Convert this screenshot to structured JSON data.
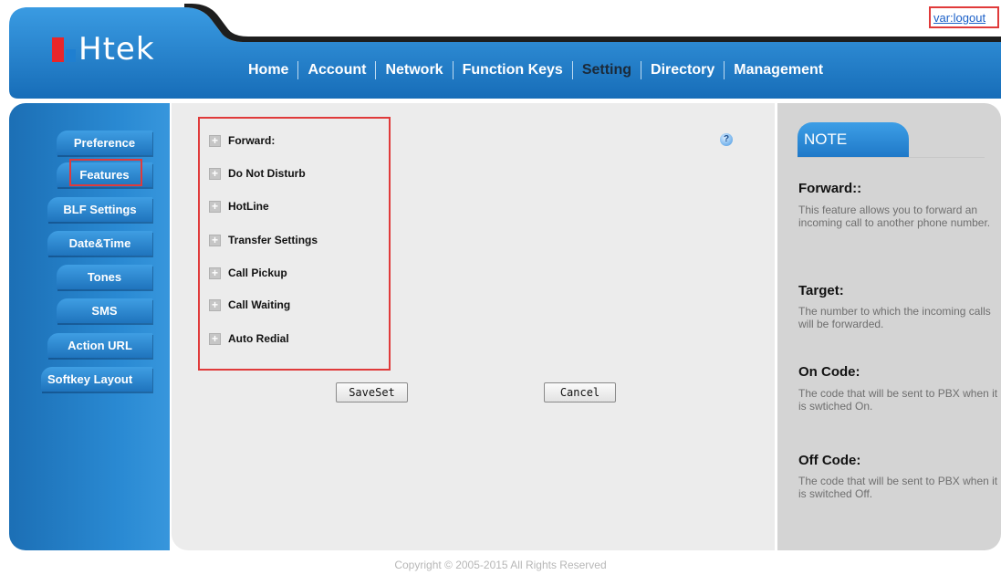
{
  "brand": {
    "logo_text": "Htek",
    "logo_colors": [
      "#e8262a",
      "#1f7fd0"
    ]
  },
  "header": {
    "logout_label": "var:logout"
  },
  "nav": {
    "items": [
      {
        "label": "Home",
        "active": false
      },
      {
        "label": "Account",
        "active": false
      },
      {
        "label": "Network",
        "active": false
      },
      {
        "label": "Function Keys",
        "active": false
      },
      {
        "label": "Setting",
        "active": true
      },
      {
        "label": "Directory",
        "active": false
      },
      {
        "label": "Management",
        "active": false
      }
    ]
  },
  "sidebar": {
    "items": [
      {
        "label": "Preference"
      },
      {
        "label": "Features",
        "selected": true
      },
      {
        "label": "BLF Settings"
      },
      {
        "label": "Date&Time"
      },
      {
        "label": "Tones"
      },
      {
        "label": "SMS"
      },
      {
        "label": "Action URL"
      },
      {
        "label": "Softkey Layout"
      }
    ]
  },
  "features": {
    "items": [
      {
        "label": "Forward:"
      },
      {
        "label": "Do Not Disturb"
      },
      {
        "label": "HotLine"
      },
      {
        "label": "Transfer Settings"
      },
      {
        "label": "Call Pickup"
      },
      {
        "label": "Call Waiting"
      },
      {
        "label": "Auto Redial"
      }
    ],
    "expand_icon": "+",
    "help_icon": "?"
  },
  "buttons": {
    "save_label": "SaveSet",
    "cancel_label": "Cancel"
  },
  "note": {
    "tab_label": "NOTE",
    "sections": [
      {
        "title": "Forward::",
        "text": "This feature allows you to forward an incoming call to another phone number."
      },
      {
        "title": "Target:",
        "text": "The number to which the incoming calls will be forwarded."
      },
      {
        "title": "On Code:",
        "text": "The code that will be sent to PBX when it is swtiched On."
      },
      {
        "title": "Off Code:",
        "text": "The code that will be sent to PBX when it is switched Off."
      }
    ]
  },
  "footer": {
    "copyright": "Copyright © 2005-2015 All Rights Reserved"
  },
  "colors": {
    "header_blue": "#1d7cc6",
    "highlight_red": "#e03a3a",
    "link_blue": "#1a5fc8"
  }
}
